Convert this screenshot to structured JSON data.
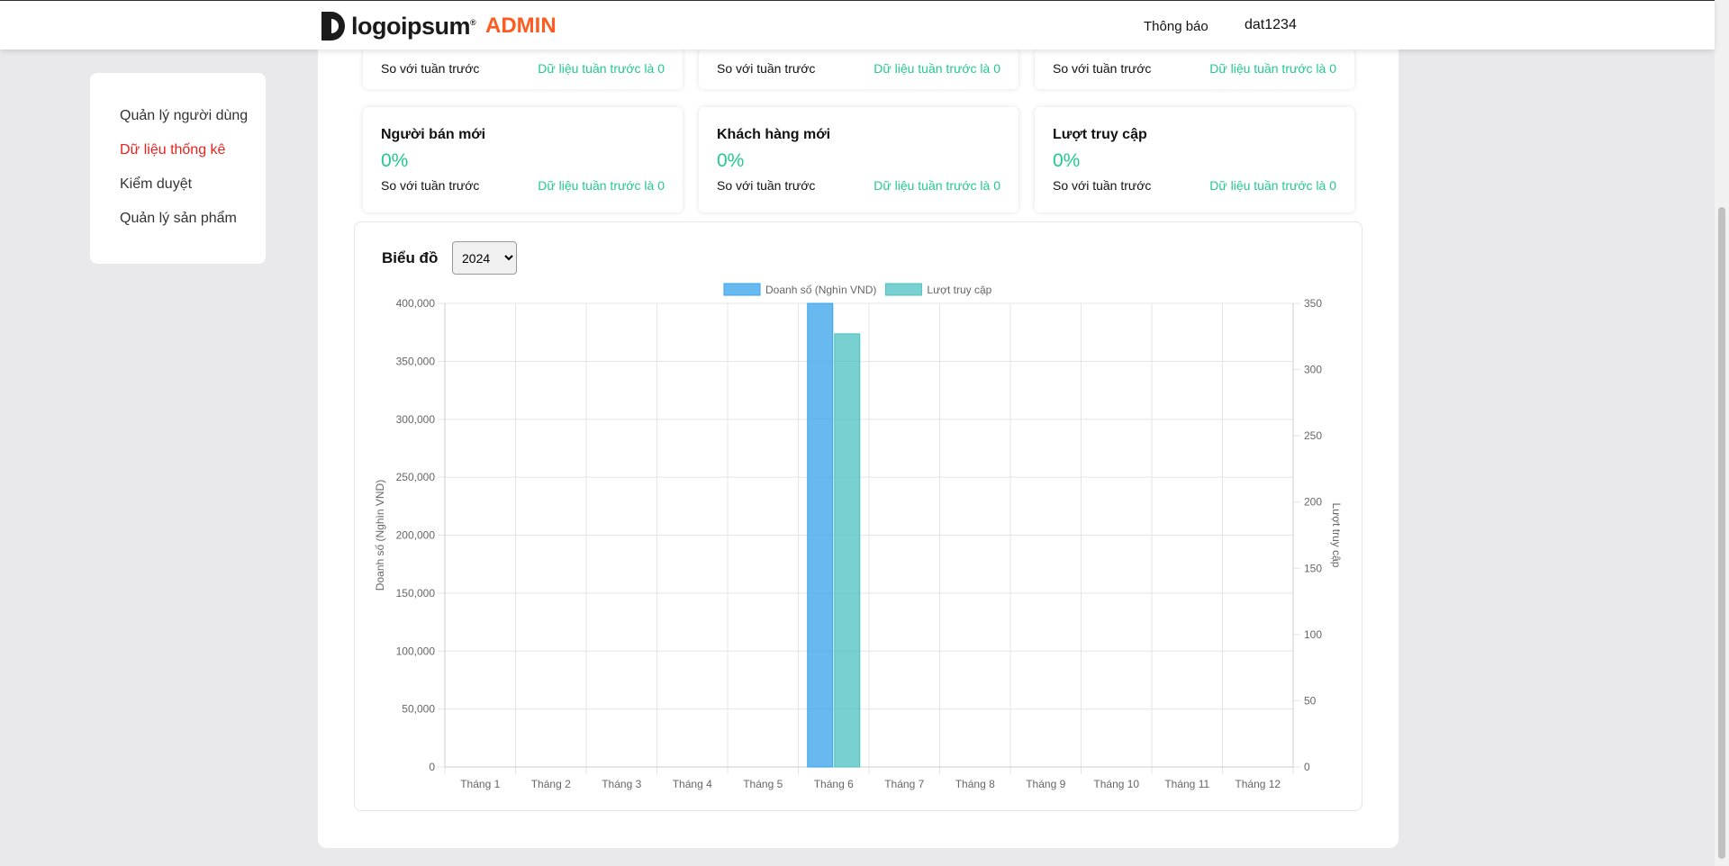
{
  "header": {
    "logo_text": "logoipsum",
    "logo_mark": "®",
    "admin_label": "ADMIN",
    "notification_label": "Thông báo",
    "username": "dat1234"
  },
  "sidebar": {
    "items": [
      {
        "label": "Quản lý người dùng",
        "active": false
      },
      {
        "label": "Dữ liệu thống kê",
        "active": true
      },
      {
        "label": "Kiểm duyệt",
        "active": false
      },
      {
        "label": "Quản lý sản phẩm",
        "active": false
      }
    ]
  },
  "top_cards": [
    {
      "compare_label": "So với tuần trước",
      "previous_label": "Dữ liệu tuần trước là 0"
    },
    {
      "compare_label": "So với tuần trước",
      "previous_label": "Dữ liệu tuần trước là 0"
    },
    {
      "compare_label": "So với tuần trước",
      "previous_label": "Dữ liệu tuần trước là 0"
    }
  ],
  "stat_cards": [
    {
      "title": "Người bán mới",
      "value": "0%",
      "compare_label": "So với tuần trước",
      "previous_label": "Dữ liệu tuần trước là 0"
    },
    {
      "title": "Khách hàng mới",
      "value": "0%",
      "compare_label": "So với tuần trước",
      "previous_label": "Dữ liệu tuần trước là 0"
    },
    {
      "title": "Lượt truy cập",
      "value": "0%",
      "compare_label": "So với tuần trước",
      "previous_label": "Dữ liệu tuần trước là 0"
    }
  ],
  "chart_section": {
    "title": "Biểu đồ",
    "year_selected": "2024",
    "year_options": [
      "2024"
    ]
  },
  "colors": {
    "accent_green": "#22c98f",
    "active_red": "#e8211d",
    "admin_orange": "#ff5a1f",
    "series_sales": "#36a2eb",
    "series_visits": "#4bc0c0"
  },
  "chart_data": {
    "type": "bar",
    "categories": [
      "Tháng 1",
      "Tháng 2",
      "Tháng 3",
      "Tháng 4",
      "Tháng 5",
      "Tháng 6",
      "Tháng 7",
      "Tháng 8",
      "Tháng 9",
      "Tháng 10",
      "Tháng 11",
      "Tháng 12"
    ],
    "series": [
      {
        "name": "Doanh số (Nghìn VND)",
        "axis": "left",
        "color": "#36a2eb",
        "values": [
          0,
          0,
          0,
          0,
          0,
          400000,
          0,
          0,
          0,
          0,
          0,
          0
        ]
      },
      {
        "name": "Lượt truy cập",
        "axis": "right",
        "color": "#4bc0c0",
        "values": [
          0,
          0,
          0,
          0,
          0,
          327,
          0,
          0,
          0,
          0,
          0,
          0
        ]
      }
    ],
    "y_left": {
      "label": "Doanh số (Nghìn VND)",
      "min": 0,
      "max": 400000,
      "ticks": [
        0,
        50000,
        100000,
        150000,
        200000,
        250000,
        300000,
        350000,
        400000
      ]
    },
    "y_right": {
      "label": "Lượt truy cập",
      "min": 0,
      "max": 350,
      "ticks": [
        0,
        50,
        100,
        150,
        200,
        250,
        300,
        350
      ]
    },
    "legend": "top",
    "grid": true
  }
}
